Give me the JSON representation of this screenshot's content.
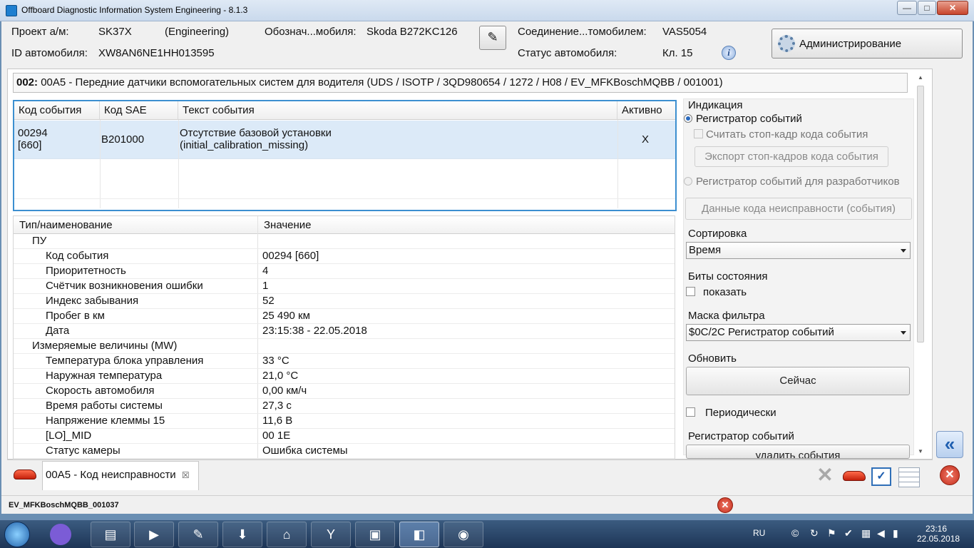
{
  "window": {
    "title": "Offboard Diagnostic Information System Engineering - 8.1.3",
    "buttons": {
      "minimize": "—",
      "maximize": "□",
      "close": "✕"
    }
  },
  "header": {
    "project_label": "Проект а/м:",
    "project_value": "SK37X",
    "project_mode": "(Engineering)",
    "designation_label": "Обознач...мобиля:",
    "designation_value": "Skoda B272KC126",
    "connection_label": "Соединение...томобилем:",
    "connection_value": "VAS5054",
    "vehicle_id_label": "ID автомобиля:",
    "vehicle_id_value": "XW8AN6NE1HH013595",
    "vehicle_status_label": "Статус автомобиля:",
    "vehicle_status_value": "Кл. 15",
    "admin_button": "Администрирование",
    "info_icon": "i"
  },
  "ecu": {
    "code": "002:",
    "description": " 00A5 - Передние датчики вспомогательных систем для водителя  (UDS / ISOTP / 3QD980654 / 1272 / H08 / EV_MFKBoschMQBB / 001001)"
  },
  "events_table": {
    "columns": [
      "Код события",
      "Код SAE",
      "Текст события",
      "Активно"
    ],
    "rows": [
      {
        "code_line1": "00294",
        "code_line2": "[660]",
        "sae": "B201000",
        "text_line1": "Отсутствие базовой установки",
        "text_line2": "(initial_calibration_missing)",
        "active": "X"
      }
    ]
  },
  "details_table": {
    "columns": [
      "Тип/наименование",
      "Значение"
    ],
    "rows": [
      {
        "name": "ПУ",
        "value": ""
      },
      {
        "name": "Код события",
        "value": "00294 [660]"
      },
      {
        "name": "Приоритетность",
        "value": "4"
      },
      {
        "name": "Счётчик возникновения ошибки",
        "value": "1"
      },
      {
        "name": "Индекс забывания",
        "value": "52"
      },
      {
        "name": "Пробег в км",
        "value": "25 490 км"
      },
      {
        "name": "Дата",
        "value": "23:15:38 - 22.05.2018"
      },
      {
        "name": "Измеряемые величины (MW)",
        "value": ""
      },
      {
        "name": "Температура блока управления",
        "value": "33 °C"
      },
      {
        "name": "Наружная температура",
        "value": "21,0 °C"
      },
      {
        "name": "Скорость автомобиля",
        "value": "0,00 км/ч"
      },
      {
        "name": "Время работы системы",
        "value": "27,3 с"
      },
      {
        "name": "Напряжение клеммы 15",
        "value": "11,6 В"
      },
      {
        "name": "[LO]_MID",
        "value": "00 1E"
      },
      {
        "name": "Статус камеры",
        "value": "Ошибка системы"
      }
    ]
  },
  "right_panel": {
    "indication_label": "Индикация",
    "radio_event_recorder": "Регистратор событий",
    "checkbox_freeze_frame": "Считать стоп-кадр кода события",
    "export_freeze_button": "Экспорт стоп-кадров кода события",
    "radio_dev_recorder": "Регистратор событий для разработчиков",
    "fault_data_button": "Данные кода неисправности (события)",
    "sort_label": "Сортировка",
    "sort_value": "Время",
    "status_bits_label": "Биты состояния",
    "show_checkbox": "показать",
    "filter_mask_label": "Маска фильтра",
    "filter_mask_value": "$0C/2C Регистратор событий",
    "refresh_label": "Обновить",
    "now_button": "Сейчас",
    "periodic_checkbox": "Периодически",
    "event_recorder_label": "Регистратор событий",
    "delete_events_button": "удалить события"
  },
  "tabs": {
    "active_tab": "00A5 - Код неисправности",
    "close_glyph": "☒"
  },
  "statusbar": {
    "text": "EV_MFKBoschMQBB_001037"
  },
  "taskbar": {
    "language": "RU",
    "time": "23:16",
    "date": "22.05.2018"
  },
  "colors": {
    "accent": "#3c8fd0",
    "selection": "#dceaf8",
    "error": "#c32b18"
  }
}
